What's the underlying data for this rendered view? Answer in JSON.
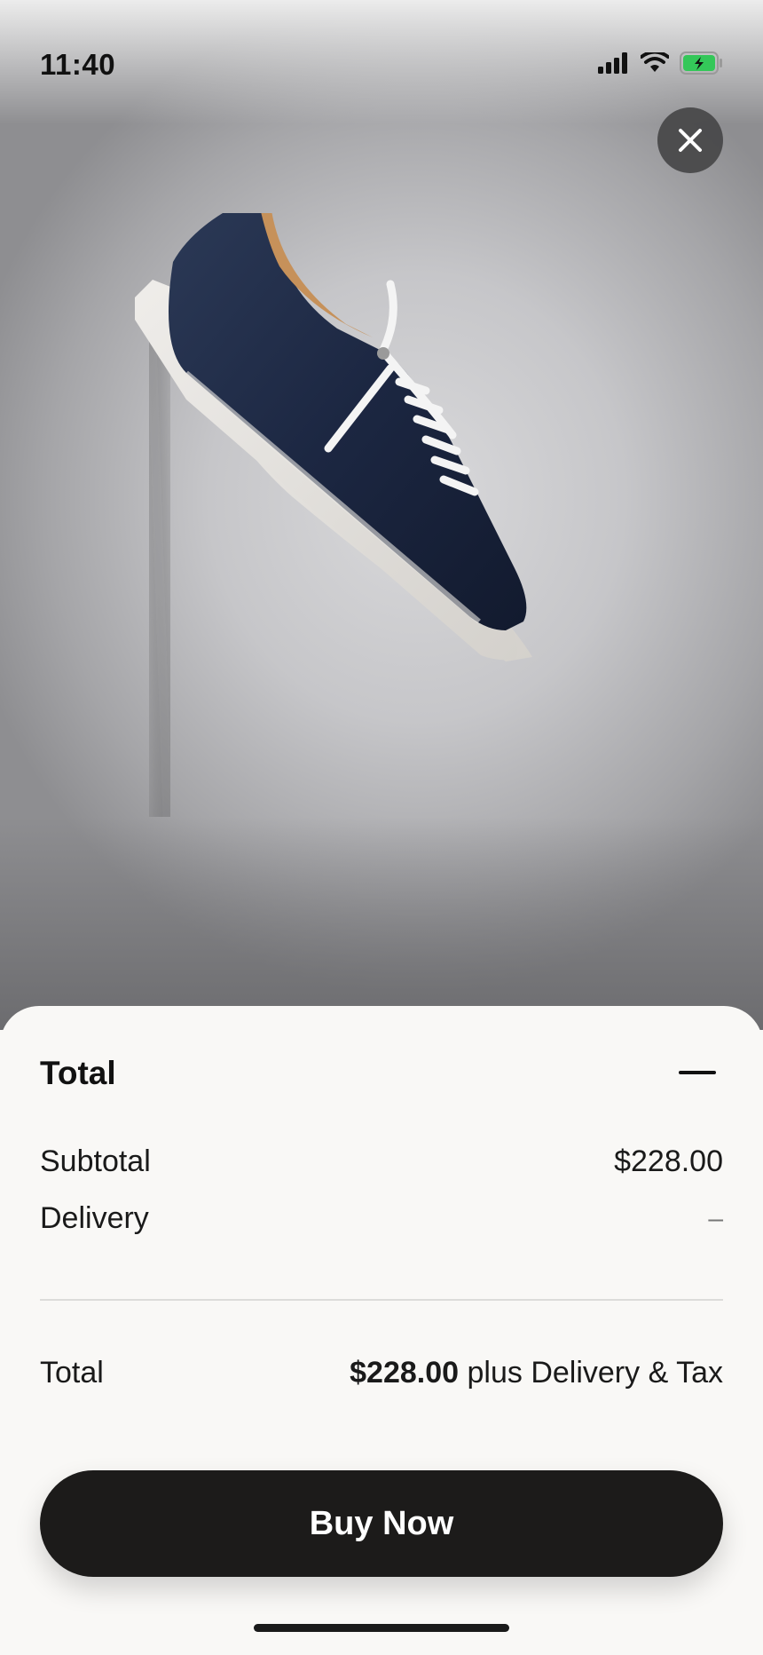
{
  "status_bar": {
    "time": "11:40",
    "icons": [
      "cellular-signal-icon",
      "wifi-icon",
      "battery-charging-icon"
    ],
    "battery_color": "#34c759"
  },
  "hero": {
    "image": "product-sneaker-photo",
    "close_icon": "close-icon"
  },
  "sheet": {
    "title": "Total",
    "collapse_icon": "minus-icon",
    "rows": [
      {
        "label": "Subtotal",
        "value": "$228.00"
      },
      {
        "label": "Delivery",
        "value": "–"
      }
    ],
    "total": {
      "label": "Total",
      "amount": "$228.00",
      "suffix": "plus Delivery & Tax"
    },
    "buy_button": "Buy Now"
  },
  "colors": {
    "button_bg": "#1c1b1a",
    "sheet_bg": "#f9f8f6",
    "text": "#111111"
  }
}
